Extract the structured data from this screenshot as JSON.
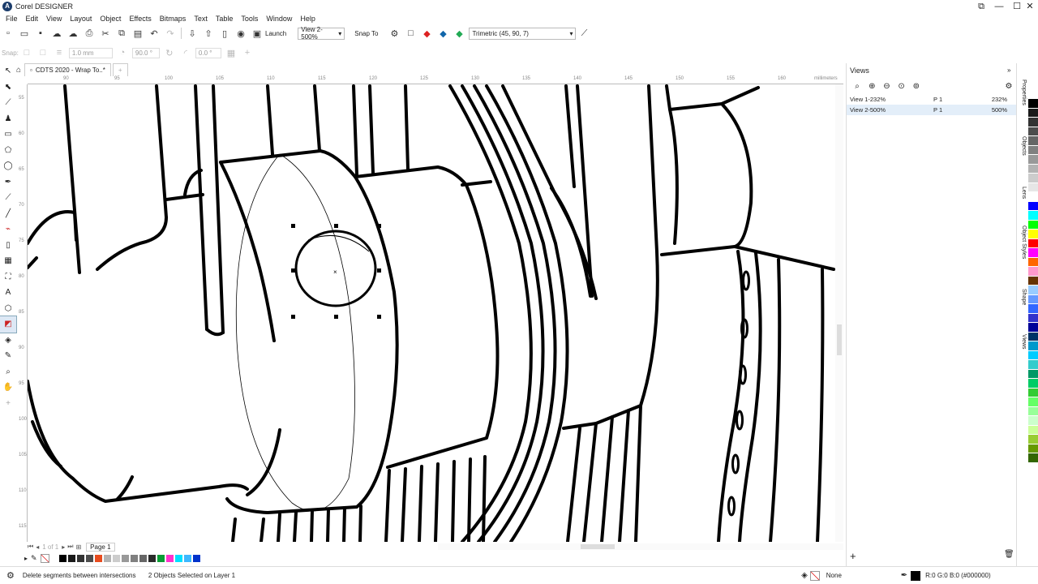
{
  "app": {
    "title": "Corel DESIGNER",
    "window_controls": [
      "⧉",
      "—",
      "☐",
      "✕"
    ]
  },
  "menu": [
    "File",
    "Edit",
    "View",
    "Layout",
    "Object",
    "Effects",
    "Bitmaps",
    "Text",
    "Table",
    "Tools",
    "Window",
    "Help"
  ],
  "toolbar": {
    "launch_label": "Launch",
    "view_select": "View 2-500%",
    "snap_label": "Snap To",
    "projection_select": "Trimetric (45, 90, 7)"
  },
  "propbar": {
    "snap": "Snap:",
    "width": "1.0 mm",
    "angle": "90.0 °",
    "offset": "0.0 °"
  },
  "document_tab": {
    "label": "CDTS 2020 - Wrap To..*"
  },
  "ruler": {
    "h_labels": [
      "90",
      "95",
      "100",
      "105",
      "110",
      "115",
      "120",
      "125",
      "130",
      "135",
      "140",
      "145",
      "150",
      "155",
      "160"
    ],
    "unit": "millimeters",
    "v_labels": [
      "55",
      "60",
      "65",
      "70",
      "75",
      "80",
      "85",
      "90",
      "95",
      "100",
      "105",
      "110",
      "115"
    ]
  },
  "pagebar": {
    "page_count": "1 of 1",
    "page_label": "Page 1"
  },
  "docker": {
    "title": "Views",
    "views": [
      {
        "name": "View 1-232%",
        "page": "P 1",
        "zoom": "232%",
        "selected": false
      },
      {
        "name": "View 2-500%",
        "page": "P 1",
        "zoom": "500%",
        "selected": true
      }
    ]
  },
  "side_tabs": [
    "Properties",
    "Objects",
    "Lens",
    "Object Styles",
    "Shape",
    "Views"
  ],
  "status": {
    "hint": "Delete segments between intersections",
    "selection": "2 Objects Selected on Layer 1",
    "fill": "None",
    "outline": "R:0 G:0 B:0 (#000000)"
  },
  "palette_bottom": [
    "#ffffff",
    "#000000",
    "#1a1a1a",
    "#333333",
    "#4d4d4d",
    "#e84c1e",
    "#b3b3b3",
    "#cccccc",
    "#999999",
    "#808080",
    "#666666",
    "#2b2b2b",
    "#0a9d35",
    "#ff33cc",
    "#00e0ff",
    "#3db8ff",
    "#0033cc"
  ],
  "palette_vertical": [
    "#000000",
    "#1a1a1a",
    "#333333",
    "#4d4d4d",
    "#666666",
    "#808080",
    "#999999",
    "#b3b3b3",
    "#cccccc",
    "#e6e6e6",
    "#ffffff",
    "#0000ff",
    "#00ffff",
    "#00ff00",
    "#ffff00",
    "#ff0000",
    "#ff00ff",
    "#ff6600",
    "#ff99cc",
    "#663300",
    "#99ccff",
    "#6699ff",
    "#3366ff",
    "#3333cc",
    "#000099",
    "#003366",
    "#0099cc",
    "#00ccff",
    "#33cccc",
    "#009966",
    "#00cc66",
    "#33cc33",
    "#66ff66",
    "#99ff99",
    "#ccffcc",
    "#ccff99",
    "#99cc33",
    "#669900",
    "#336600"
  ]
}
